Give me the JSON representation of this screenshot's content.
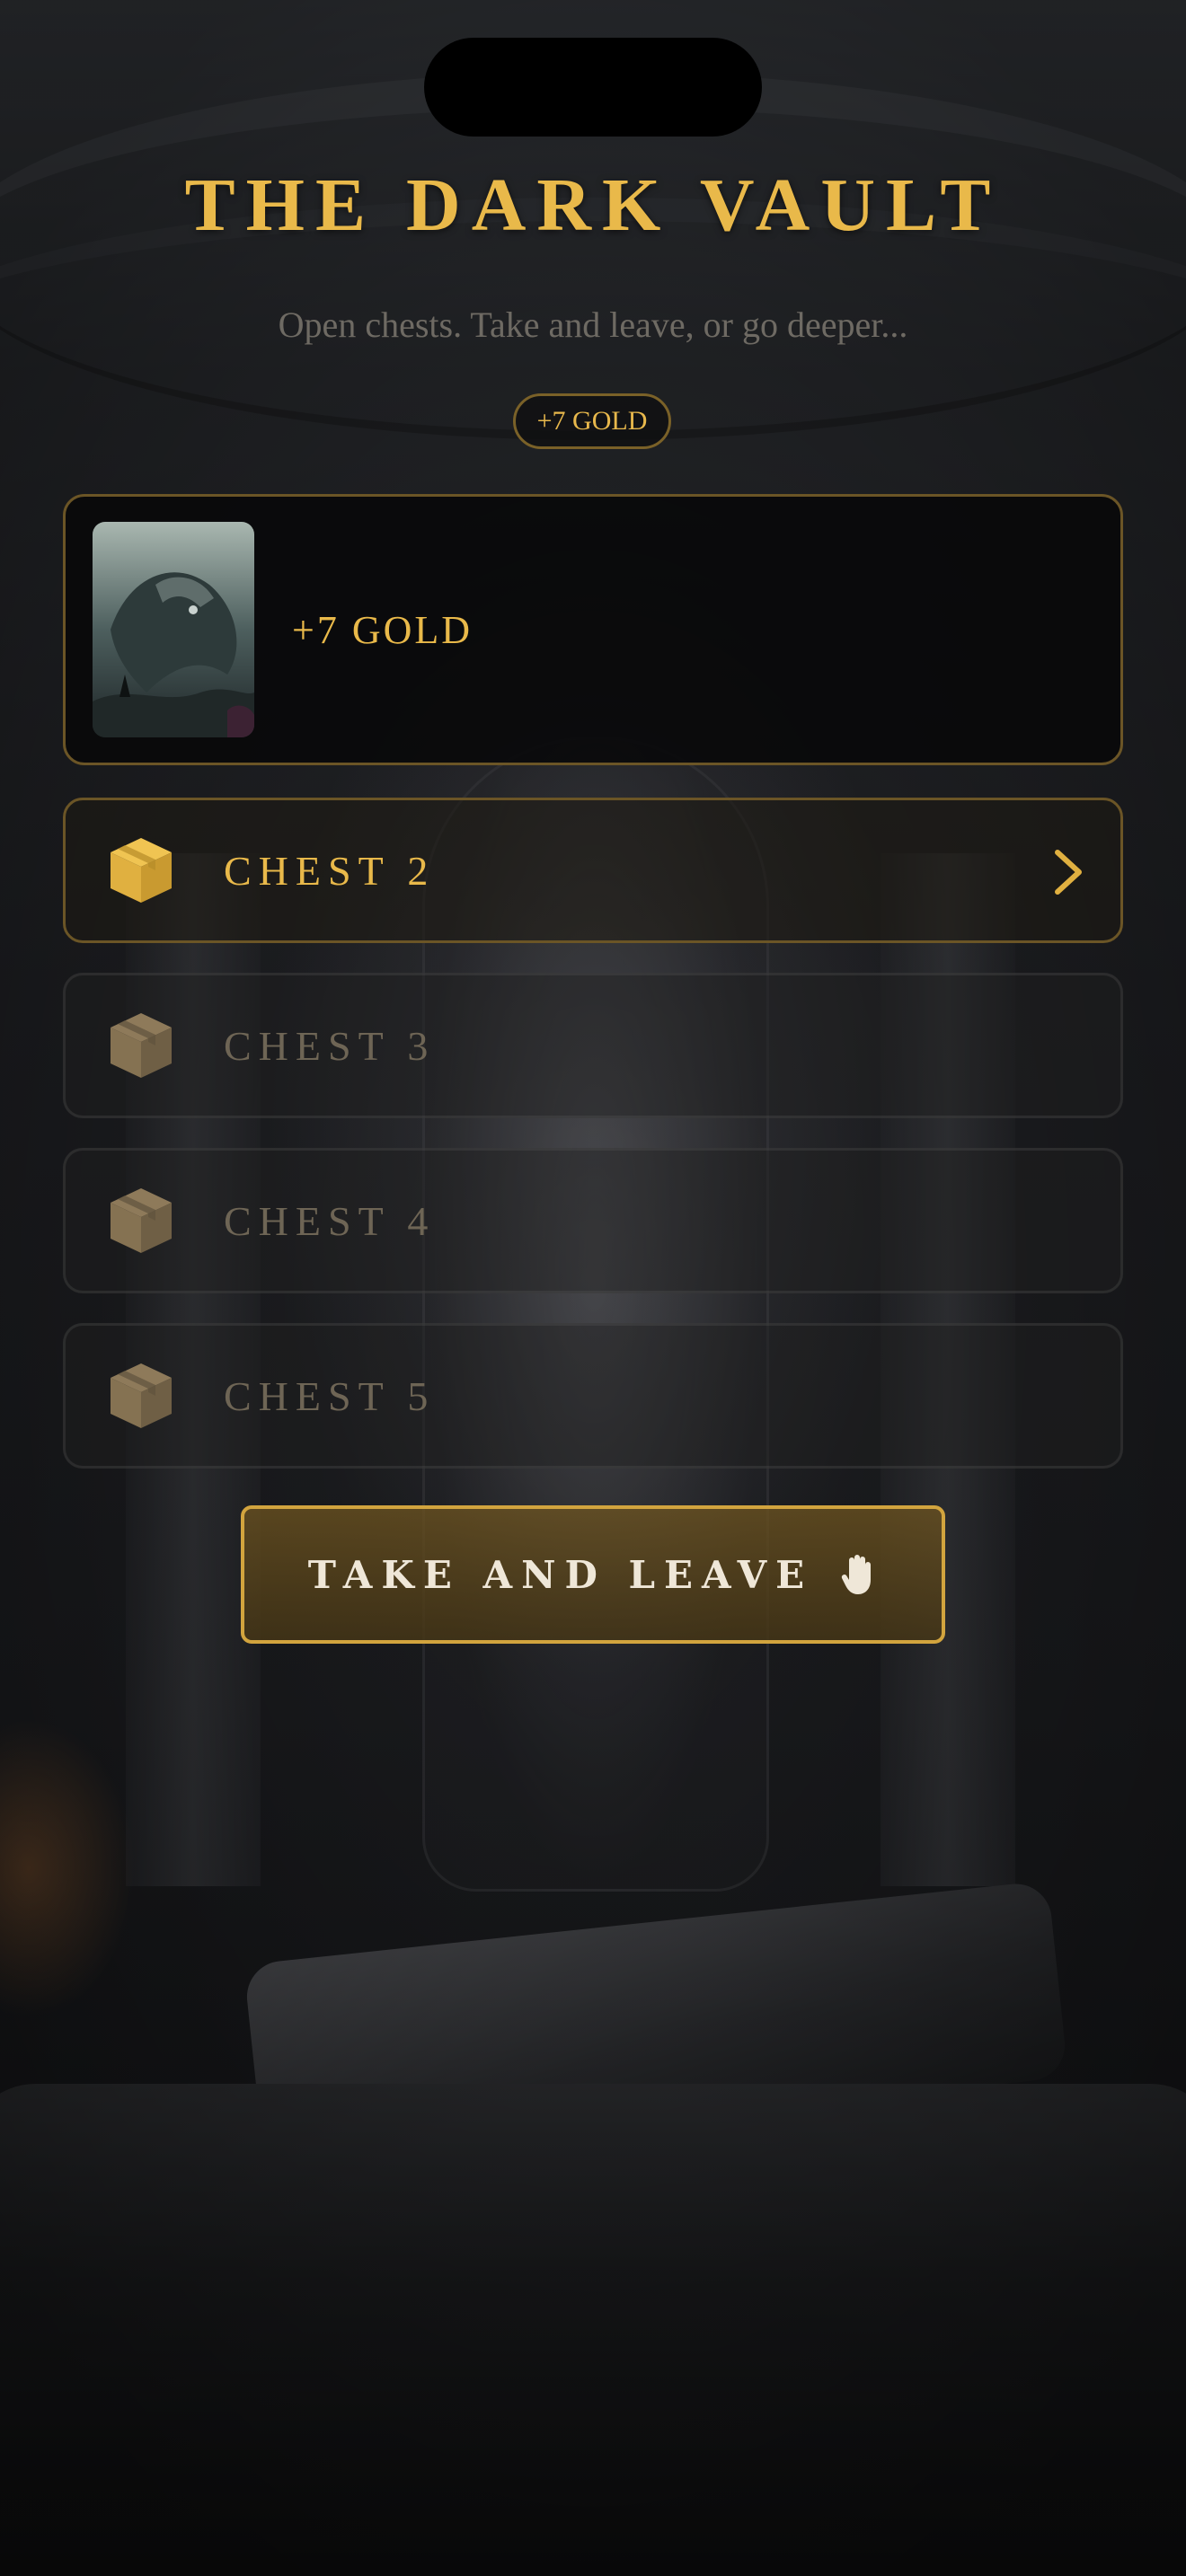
{
  "header": {
    "title": "THE DARK VAULT",
    "subtitle": "Open chests. Take and leave, or go deeper..."
  },
  "gold_badge": "+7 GOLD",
  "reward": {
    "label": "+7 GOLD",
    "image_icon": "monster-card-art"
  },
  "chests": [
    {
      "label": "CHEST 2",
      "state": "available",
      "icon": "box-icon"
    },
    {
      "label": "CHEST 3",
      "state": "locked",
      "icon": "box-icon"
    },
    {
      "label": "CHEST 4",
      "state": "locked",
      "icon": "box-icon"
    },
    {
      "label": "CHEST 5",
      "state": "locked",
      "icon": "box-icon"
    }
  ],
  "actions": {
    "take_and_leave": "TAKE AND LEAVE",
    "take_and_leave_icon": "hand-icon"
  },
  "colors": {
    "gold": "#e9b94a",
    "gold_border": "#6b5526",
    "locked_text": "#6e6555",
    "button_border": "#d2a43e"
  }
}
